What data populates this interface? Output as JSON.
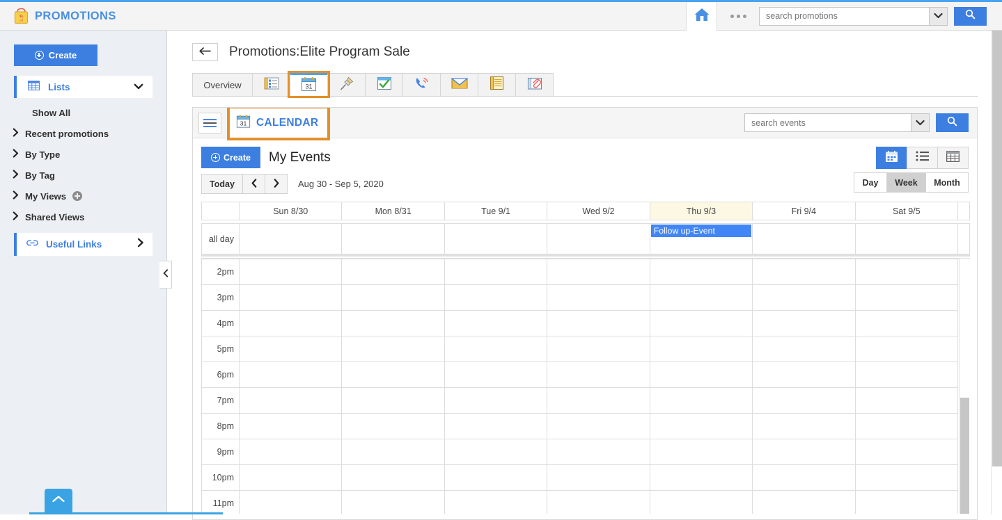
{
  "app": {
    "brand_title": "PROMOTIONS",
    "brand_icon": "promotions-bag-icon"
  },
  "header": {
    "home_icon": "home-icon",
    "overflow_icon": "ellipsis-icon",
    "search": {
      "placeholder": "search promotions",
      "value": "",
      "caret_icon": "chevron-down-icon",
      "go_icon": "search-icon"
    }
  },
  "sidebar": {
    "create_label": "Create",
    "lists": {
      "label": "Lists",
      "icon": "grid-icon",
      "chevron": "chevron-down-icon"
    },
    "items": [
      {
        "label": "Show All",
        "has_arrow": false
      },
      {
        "label": "Recent promotions",
        "has_arrow": true
      },
      {
        "label": "By Type",
        "has_arrow": true
      },
      {
        "label": "By Tag",
        "has_arrow": true
      },
      {
        "label": "My Views",
        "has_arrow": true,
        "add_icon": "plus-circle-icon"
      },
      {
        "label": "Shared Views",
        "has_arrow": true
      }
    ],
    "useful_links": {
      "label": "Useful Links",
      "icon": "link-icon",
      "chevron": "chevron-right-icon"
    },
    "collapse_icon": "chevron-left-icon",
    "scroll_top_icon": "chevron-up-icon"
  },
  "page": {
    "back_icon": "back-arrow-icon",
    "title": "Promotions:Elite Program Sale"
  },
  "tabs": [
    {
      "label": "Overview",
      "type": "text",
      "icon": "",
      "active": false,
      "highlighted": false
    },
    {
      "label": "",
      "type": "icon",
      "icon": "details-list-icon",
      "active": false,
      "highlighted": false
    },
    {
      "label": "",
      "type": "icon",
      "icon": "calendar-31-icon",
      "active": true,
      "highlighted": true
    },
    {
      "label": "",
      "type": "icon",
      "icon": "pushpin-icon",
      "active": false,
      "highlighted": false
    },
    {
      "label": "",
      "type": "icon",
      "icon": "task-checkmark-icon",
      "active": false,
      "highlighted": false
    },
    {
      "label": "",
      "type": "icon",
      "icon": "phone-call-icon",
      "active": false,
      "highlighted": false
    },
    {
      "label": "",
      "type": "icon",
      "icon": "email-envelope-icon",
      "active": false,
      "highlighted": false
    },
    {
      "label": "",
      "type": "icon",
      "icon": "notes-icon",
      "active": false,
      "highlighted": false
    },
    {
      "label": "",
      "type": "icon",
      "icon": "attachment-folder-icon",
      "active": false,
      "highlighted": false
    }
  ],
  "module": {
    "burger_icon": "hamburger-menu-icon",
    "title": "CALENDAR",
    "title_icon": "calendar-31-icon",
    "search": {
      "placeholder": "search events",
      "value": "",
      "caret_icon": "chevron-down-icon",
      "go_icon": "search-icon"
    },
    "toolbar": {
      "create_label": "Create",
      "heading": "My Events",
      "views": [
        {
          "name": "calendar-view",
          "icon": "calendar-icon",
          "selected": true
        },
        {
          "name": "list-view",
          "icon": "list-icon",
          "selected": false
        },
        {
          "name": "table-view",
          "icon": "table-icon",
          "selected": false
        }
      ]
    },
    "nav": {
      "today_label": "Today",
      "prev_icon": "chevron-left-icon",
      "next_icon": "chevron-right-icon",
      "range_label": "Aug 30 - Sep 5, 2020",
      "periods": [
        {
          "label": "Day",
          "selected": false
        },
        {
          "label": "Week",
          "selected": true
        },
        {
          "label": "Month",
          "selected": false
        }
      ]
    }
  },
  "calendar": {
    "allday_label": "all day",
    "days": [
      {
        "label": "Sun 8/30",
        "today": false
      },
      {
        "label": "Mon 8/31",
        "today": false
      },
      {
        "label": "Tue 9/1",
        "today": false
      },
      {
        "label": "Wed 9/2",
        "today": false
      },
      {
        "label": "Thu 9/3",
        "today": true
      },
      {
        "label": "Fri 9/4",
        "today": false
      },
      {
        "label": "Sat 9/5",
        "today": false
      }
    ],
    "allday_events": [
      {
        "day_index": 4,
        "title": "Follow up-Event",
        "color": "#4286f5"
      }
    ],
    "time_slots": [
      "2pm",
      "3pm",
      "4pm",
      "5pm",
      "6pm",
      "7pm",
      "8pm",
      "9pm",
      "10pm",
      "11pm"
    ]
  },
  "colors": {
    "brand_blue": "#4a90e2",
    "accent_blue": "#3d7fe0",
    "highlight_orange": "#e39029",
    "today_bg": "#fcf8e3",
    "event_blue": "#4286f5"
  }
}
